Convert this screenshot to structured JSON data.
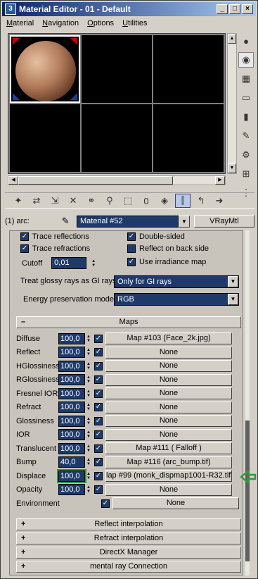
{
  "window": {
    "title": "Material Editor - 01 - Default",
    "min": "_",
    "max": "□",
    "close": "×"
  },
  "menu": [
    "Material",
    "Navigation",
    "Options",
    "Utilities"
  ],
  "material": {
    "slot_label": "(1) arc:",
    "name": "Material #52",
    "type": "VRayMtl"
  },
  "options": {
    "trace_reflections": "Trace reflections",
    "trace_refractions": "Trace refractions",
    "double_sided": "Double-sided",
    "reflect_on_back_side": "Reflect on back side",
    "use_irradiance_map": "Use irradiance map",
    "cutoff_label": "Cutoff",
    "cutoff_value": "0,01",
    "glossy_label": "Treat glossy rays as GI rays:",
    "glossy_value": "Only for GI rays",
    "energy_label": "Energy preservation mode:",
    "energy_value": "RGB"
  },
  "maps": {
    "header": "Maps",
    "rows": [
      {
        "name": "Diffuse",
        "value": "100,0",
        "map": "Map #103 (Face_2k.jpg)"
      },
      {
        "name": "Reflect",
        "value": "100,0",
        "map": "None"
      },
      {
        "name": "HGlossiness",
        "value": "100,0",
        "map": "None"
      },
      {
        "name": "RGlossiness",
        "value": "100,0",
        "map": "None"
      },
      {
        "name": "Fresnel IOR",
        "value": "100,0",
        "map": "None"
      },
      {
        "name": "Refract",
        "value": "100,0",
        "map": "None"
      },
      {
        "name": "Glossiness",
        "value": "100,0",
        "map": "None"
      },
      {
        "name": "IOR",
        "value": "100,0",
        "map": "None"
      },
      {
        "name": "Translucent",
        "value": "100,0",
        "map": "Map #111 ( Falloff )"
      },
      {
        "name": "Bump",
        "value": "40,0",
        "map": "Map #116 (arc_bump.tif)"
      },
      {
        "name": "Displace",
        "value": "100,0",
        "map": "lap #99 (monk_dispmap1001-R32.tif)"
      },
      {
        "name": "Opacity",
        "value": "100,0",
        "map": "None"
      },
      {
        "name": "Environment",
        "value": "",
        "map": "None"
      }
    ]
  },
  "rollouts": {
    "reflect_interpolation": "Reflect interpolation",
    "refract_interpolation": "Refract interpolation",
    "directx": "DirectX Manager",
    "mental_ray": "mental ray Connection"
  },
  "colors": {
    "accent_highlight": "#2e9a3a",
    "field_bg": "#1e3a6a"
  }
}
